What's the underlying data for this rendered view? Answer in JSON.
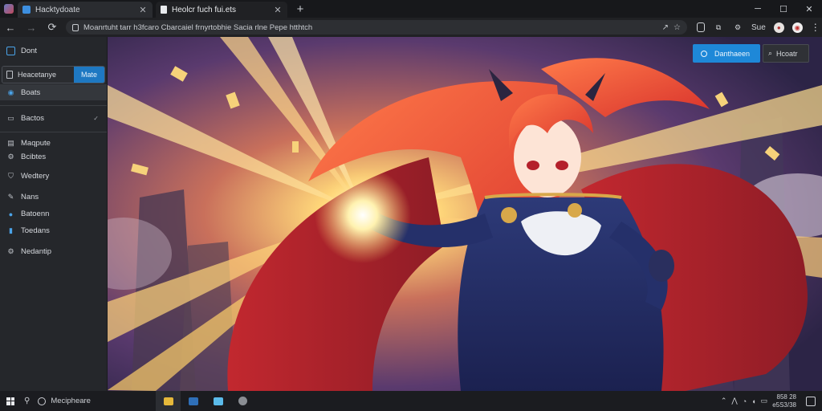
{
  "browser": {
    "tabs": [
      {
        "label": "Hacktydoate",
        "active": false
      },
      {
        "label": "Heolcr fuch fui.ets",
        "active": true
      }
    ],
    "new_tab_symbol": "+",
    "window_controls": [
      "─",
      "☐",
      "✕"
    ],
    "url": "Moanrtuht tarr h3fcaro Cbarcaiel frnyrtobhie Sacia rlne Pepe htthtch",
    "extension_icon_label": "Sue"
  },
  "sidebar": {
    "top_item": "Dont",
    "search": {
      "placeholder": "Heacetanye",
      "more_label": "Mate"
    },
    "items": [
      {
        "label": "Boats",
        "icon": "tag-icon",
        "active": true
      },
      {
        "label": "Bactos",
        "icon": "dashboard-icon",
        "chevron": true
      },
      {
        "label": "Maqpute",
        "icon": "document-icon"
      },
      {
        "label": "Bcibtes",
        "icon": "settings-icon"
      },
      {
        "label": "Wedtery",
        "icon": "shield-icon"
      },
      {
        "label": "Nans",
        "icon": "pen-icon"
      },
      {
        "label": "Batoenn",
        "icon": "info-icon"
      },
      {
        "label": "Toedans",
        "icon": "bookmark-icon"
      },
      {
        "label": "Nedantip",
        "icon": "gear-icon"
      }
    ]
  },
  "content": {
    "primary_button": "Danthaeen",
    "secondary_button": "Hcoatr"
  },
  "taskbar": {
    "search_label": "Mecipheare",
    "clock_time": "858 28",
    "clock_date": "e5S3/38"
  }
}
